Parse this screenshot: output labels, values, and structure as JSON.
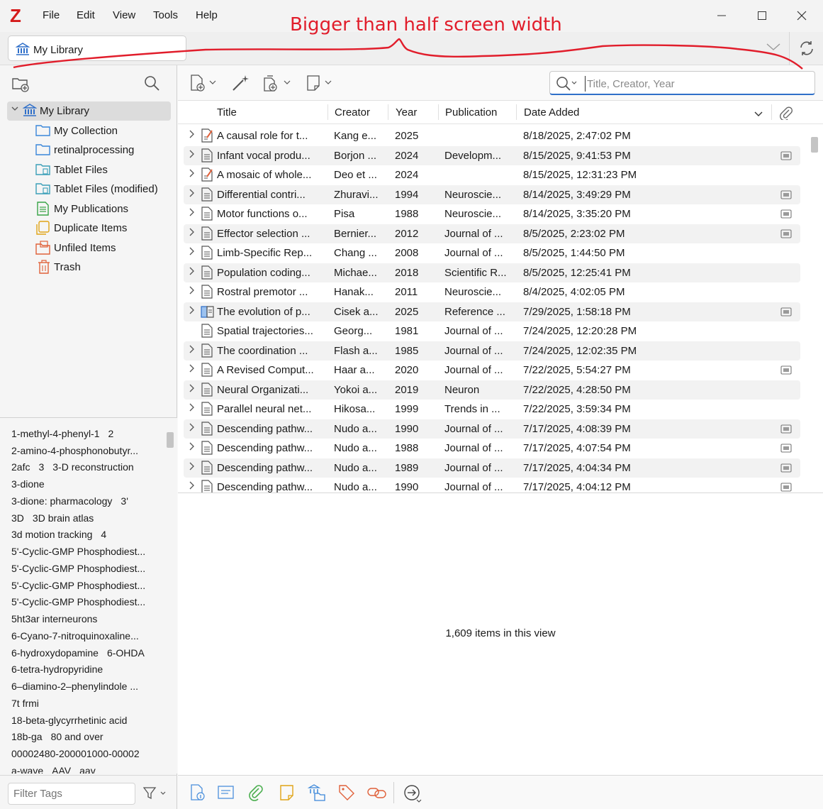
{
  "menubar": {
    "logo": "Z",
    "items": [
      "File",
      "Edit",
      "View",
      "Tools",
      "Help"
    ]
  },
  "window_controls": [
    "minimize",
    "maximize",
    "close"
  ],
  "tab": {
    "label": "My Library"
  },
  "annotation": {
    "text": "Bigger than half screen width",
    "color": "#e11d2b"
  },
  "collections": [
    {
      "label": "My Library",
      "icon": "library-icon",
      "selected": true
    },
    {
      "label": "My Collection",
      "icon": "folder-icon"
    },
    {
      "label": "retinalprocessing",
      "icon": "folder-icon"
    },
    {
      "label": "Tablet Files",
      "icon": "tablet-folder-icon"
    },
    {
      "label": "Tablet Files (modified)",
      "icon": "tablet-folder-icon"
    },
    {
      "label": "My Publications",
      "icon": "publications-icon"
    },
    {
      "label": "Duplicate Items",
      "icon": "duplicate-icon"
    },
    {
      "label": "Unfiled Items",
      "icon": "unfiled-icon"
    },
    {
      "label": "Trash",
      "icon": "trash-icon"
    }
  ],
  "tags": [
    [
      "1-methyl-4-phenyl-1",
      "2"
    ],
    [
      "2-amino-4-phosphonobutyr..."
    ],
    [
      "2afc",
      "3",
      "3-D reconstruction"
    ],
    [
      "3-dione"
    ],
    [
      "3-dione: pharmacology",
      "3'"
    ],
    [
      "3D",
      "3D brain atlas"
    ],
    [
      "3d motion tracking",
      "4"
    ],
    [
      "5'-Cyclic-GMP Phosphodiest..."
    ],
    [
      "5'-Cyclic-GMP Phosphodiest..."
    ],
    [
      "5'-Cyclic-GMP Phosphodiest..."
    ],
    [
      "5'-Cyclic-GMP Phosphodiest..."
    ],
    [
      "5ht3ar interneurons"
    ],
    [
      "6-Cyano-7-nitroquinoxaline..."
    ],
    [
      "6-hydroxydopamine",
      "6-OHDA"
    ],
    [
      "6-tetra-hydropyridine"
    ],
    [
      "6–diamino-2–phenylindole ..."
    ],
    [
      "7t frmi"
    ],
    [
      "18-beta-glycyrrhetinic acid"
    ],
    [
      "18b-ga",
      "80 and over"
    ],
    [
      "00002480-200001000-00002"
    ],
    [
      "a-wave",
      "AAV",
      "aav"
    ]
  ],
  "tag_filter": {
    "placeholder": "Filter Tags"
  },
  "search": {
    "placeholder": "Title, Creator, Year"
  },
  "columns": [
    "Title",
    "Creator",
    "Year",
    "Publication",
    "Date Added"
  ],
  "items": [
    {
      "title": "A causal role for t...",
      "creator": "Kang e...",
      "year": "2025",
      "publication": "",
      "date_added": "8/18/2025, 2:47:02 PM",
      "type": "preprint",
      "attachment": false,
      "expandable": true
    },
    {
      "title": "Infant vocal produ...",
      "creator": "Borjon ...",
      "year": "2024",
      "publication": "Developm...",
      "date_added": "8/15/2025, 9:41:53 PM",
      "type": "article",
      "attachment": true,
      "expandable": true
    },
    {
      "title": "A mosaic of whole...",
      "creator": "Deo et ...",
      "year": "2024",
      "publication": "",
      "date_added": "8/15/2025, 12:31:23 PM",
      "type": "preprint",
      "attachment": false,
      "expandable": true
    },
    {
      "title": "Differential contri...",
      "creator": "Zhuravi...",
      "year": "1994",
      "publication": "Neuroscie...",
      "date_added": "8/14/2025, 3:49:29 PM",
      "type": "article",
      "attachment": true,
      "expandable": true
    },
    {
      "title": "Motor functions o...",
      "creator": "Pisa",
      "year": "1988",
      "publication": "Neuroscie...",
      "date_added": "8/14/2025, 3:35:20 PM",
      "type": "article",
      "attachment": true,
      "expandable": true
    },
    {
      "title": "Effector selection ...",
      "creator": "Bernier...",
      "year": "2012",
      "publication": "Journal of ...",
      "date_added": "8/5/2025, 2:23:02 PM",
      "type": "article",
      "attachment": true,
      "expandable": true
    },
    {
      "title": "Limb-Specific Rep...",
      "creator": "Chang ...",
      "year": "2008",
      "publication": "Journal of ...",
      "date_added": "8/5/2025, 1:44:50 PM",
      "type": "article",
      "attachment": false,
      "expandable": true
    },
    {
      "title": "Population coding...",
      "creator": "Michae...",
      "year": "2018",
      "publication": "Scientific R...",
      "date_added": "8/5/2025, 12:25:41 PM",
      "type": "article",
      "attachment": false,
      "expandable": true
    },
    {
      "title": "Rostral premotor ...",
      "creator": "Hanak...",
      "year": "2011",
      "publication": "Neuroscie...",
      "date_added": "8/4/2025, 4:02:05 PM",
      "type": "article",
      "attachment": false,
      "expandable": true
    },
    {
      "title": "The evolution of p...",
      "creator": "Cisek a...",
      "year": "2025",
      "publication": "Reference ...",
      "date_added": "7/29/2025, 1:58:18 PM",
      "type": "book-section",
      "attachment": true,
      "expandable": true
    },
    {
      "title": "Spatial trajectories...",
      "creator": "Georg...",
      "year": "1981",
      "publication": "Journal of ...",
      "date_added": "7/24/2025, 12:20:28 PM",
      "type": "article",
      "attachment": false,
      "expandable": false
    },
    {
      "title": "The coordination ...",
      "creator": "Flash a...",
      "year": "1985",
      "publication": "Journal of ...",
      "date_added": "7/24/2025, 12:02:35 PM",
      "type": "article",
      "attachment": false,
      "expandable": true
    },
    {
      "title": "A Revised Comput...",
      "creator": "Haar a...",
      "year": "2020",
      "publication": "Journal of ...",
      "date_added": "7/22/2025, 5:54:27 PM",
      "type": "article",
      "attachment": true,
      "expandable": true
    },
    {
      "title": "Neural Organizati...",
      "creator": "Yokoi a...",
      "year": "2019",
      "publication": "Neuron",
      "date_added": "7/22/2025, 4:28:50 PM",
      "type": "article",
      "attachment": false,
      "expandable": true
    },
    {
      "title": "Parallel neural net...",
      "creator": "Hikosa...",
      "year": "1999",
      "publication": "Trends in ...",
      "date_added": "7/22/2025, 3:59:34 PM",
      "type": "article",
      "attachment": false,
      "expandable": true
    },
    {
      "title": "Descending pathw...",
      "creator": "Nudo a...",
      "year": "1990",
      "publication": "Journal of ...",
      "date_added": "7/17/2025, 4:08:39 PM",
      "type": "article",
      "attachment": true,
      "expandable": true
    },
    {
      "title": "Descending pathw...",
      "creator": "Nudo a...",
      "year": "1988",
      "publication": "Journal of ...",
      "date_added": "7/17/2025, 4:07:54 PM",
      "type": "article",
      "attachment": true,
      "expandable": true
    },
    {
      "title": "Descending pathw...",
      "creator": "Nudo a...",
      "year": "1989",
      "publication": "Journal of ...",
      "date_added": "7/17/2025, 4:04:34 PM",
      "type": "article",
      "attachment": true,
      "expandable": true
    },
    {
      "title": "Descending pathw...",
      "creator": "Nudo a...",
      "year": "1990",
      "publication": "Journal of ...",
      "date_added": "7/17/2025, 4:04:12 PM",
      "type": "article",
      "attachment": true,
      "expandable": true
    }
  ],
  "status": {
    "count_message": "1,609 items in this view"
  },
  "colors": {
    "accent": "#2f6fc9",
    "logo": "#d51b1b",
    "annotation": "#e11d2b"
  }
}
